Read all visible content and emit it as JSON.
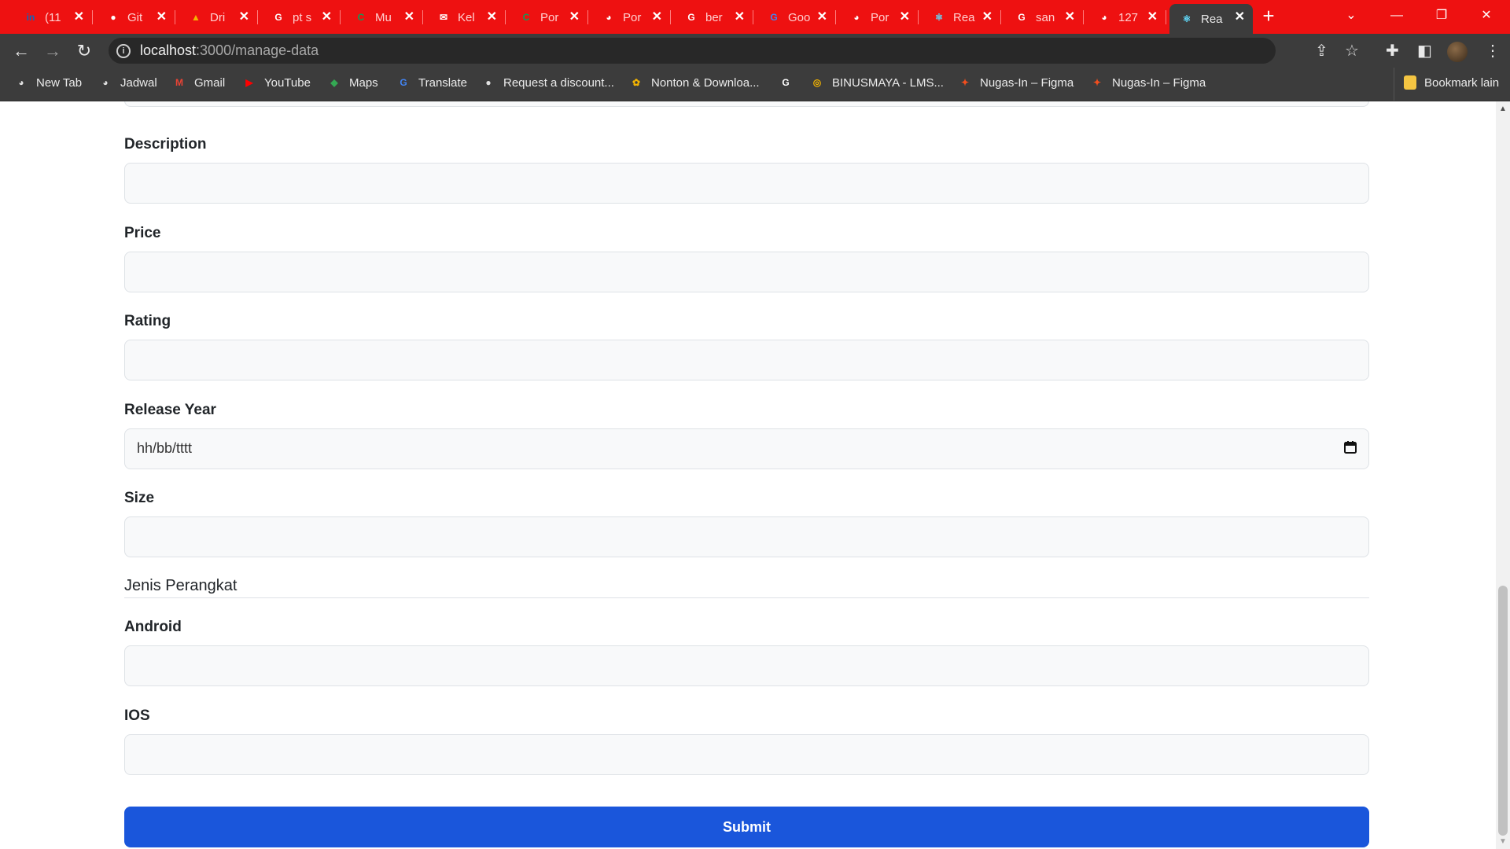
{
  "browser": {
    "tabs": [
      {
        "title": "(11",
        "icon": "linkedin-icon",
        "icon_text": "in",
        "icon_color": "#0a66c2"
      },
      {
        "title": "Git",
        "icon": "github-icon",
        "icon_text": "●",
        "icon_color": "#ffffff"
      },
      {
        "title": "Dri",
        "icon": "drive-icon",
        "icon_text": "▲",
        "icon_color": "#f4b400"
      },
      {
        "title": "pt s",
        "icon": "google-icon",
        "icon_text": "G",
        "icon_color": "#ffffff"
      },
      {
        "title": "Mu",
        "icon": "canva-icon",
        "icon_text": "C",
        "icon_color": "#0f9d58"
      },
      {
        "title": "Kel",
        "icon": "classroom-icon",
        "icon_text": "✉",
        "icon_color": "#ffffff"
      },
      {
        "title": "Por",
        "icon": "canva-icon",
        "icon_text": "C",
        "icon_color": "#0f9d58"
      },
      {
        "title": "Por",
        "icon": "globe-icon",
        "icon_text": "◕",
        "icon_color": "#ffffff"
      },
      {
        "title": "ber",
        "icon": "google-icon",
        "icon_text": "G",
        "icon_color": "#ffffff"
      },
      {
        "title": "Goo",
        "icon": "translate-icon",
        "icon_text": "G",
        "icon_color": "#4285f4"
      },
      {
        "title": "Por",
        "icon": "globe-icon",
        "icon_text": "◕",
        "icon_color": "#ffffff"
      },
      {
        "title": "Rea",
        "icon": "react-icon",
        "icon_text": "⚛",
        "icon_color": "#61dafb"
      },
      {
        "title": "san",
        "icon": "google-icon",
        "icon_text": "G",
        "icon_color": "#ffffff"
      },
      {
        "title": "127",
        "icon": "globe-icon",
        "icon_text": "◕",
        "icon_color": "#ffffff"
      },
      {
        "title": "Rea",
        "icon": "react-icon",
        "icon_text": "⚛",
        "icon_color": "#61dafb",
        "active": true
      }
    ],
    "url_host": "localhost",
    "url_path": ":3000/manage-data",
    "bookmarks": [
      {
        "label": "New Tab",
        "icon": "globe-icon",
        "icon_text": "◕",
        "icon_color": "#e0e0e0"
      },
      {
        "label": "Jadwal",
        "icon": "globe-icon",
        "icon_text": "◕",
        "icon_color": "#e0e0e0"
      },
      {
        "label": "Gmail",
        "icon": "gmail-icon",
        "icon_text": "M",
        "icon_color": "#ea4335"
      },
      {
        "label": "YouTube",
        "icon": "youtube-icon",
        "icon_text": "▶",
        "icon_color": "#ff0000"
      },
      {
        "label": "Maps",
        "icon": "maps-icon",
        "icon_text": "◆",
        "icon_color": "#34a853"
      },
      {
        "label": "Translate",
        "icon": "translate-icon",
        "icon_text": "G",
        "icon_color": "#4285f4"
      },
      {
        "label": "Request a discount...",
        "icon": "github-icon",
        "icon_text": "●",
        "icon_color": "#e0e0e0"
      },
      {
        "label": "Nonton & Downloa...",
        "icon": "app-icon",
        "icon_text": "✿",
        "icon_color": "#f4b400"
      },
      {
        "label": "",
        "icon": "google-icon",
        "icon_text": "G",
        "icon_color": "#ffffff"
      },
      {
        "label": "BINUSMAYA - LMS...",
        "icon": "binus-icon",
        "icon_text": "◎",
        "icon_color": "#f4b400"
      },
      {
        "label": "Nugas-In – Figma",
        "icon": "figma-icon",
        "icon_text": "✦",
        "icon_color": "#f24e1e"
      },
      {
        "label": "Nugas-In – Figma",
        "icon": "figma-icon",
        "icon_text": "✦",
        "icon_color": "#f24e1e"
      }
    ],
    "other_bookmarks": "Bookmark lain"
  },
  "form": {
    "fields": [
      {
        "label": "Description",
        "value": ""
      },
      {
        "label": "Price",
        "value": ""
      },
      {
        "label": "Rating",
        "value": ""
      },
      {
        "label": "Release Year",
        "value": "hh/bb/tttt",
        "type": "date"
      },
      {
        "label": "Size",
        "value": ""
      }
    ],
    "section_title": "Jenis Perangkat",
    "device_fields": [
      {
        "label": "Android",
        "value": ""
      },
      {
        "label": "IOS",
        "value": ""
      }
    ],
    "submit_label": "Submit",
    "accent_color": "#1a56db"
  }
}
